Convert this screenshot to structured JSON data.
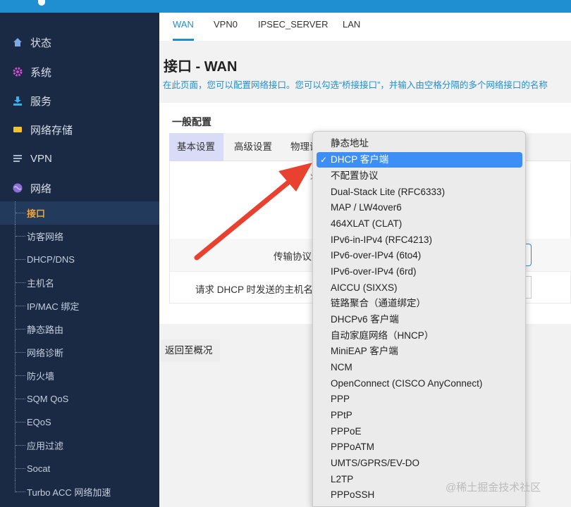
{
  "sidebar": {
    "menu": [
      {
        "label": "状态",
        "icon": "home-icon"
      },
      {
        "label": "系统",
        "icon": "gear-icon"
      },
      {
        "label": "服务",
        "icon": "download-icon"
      },
      {
        "label": "网络存储",
        "icon": "drive-icon"
      },
      {
        "label": "VPN",
        "icon": "list-icon"
      },
      {
        "label": "网络",
        "icon": "globe-icon"
      }
    ],
    "sub": [
      {
        "label": "接口"
      },
      {
        "label": "访客网络"
      },
      {
        "label": "DHCP/DNS"
      },
      {
        "label": "主机名"
      },
      {
        "label": "IP/MAC 绑定"
      },
      {
        "label": "静态路由"
      },
      {
        "label": "网络诊断"
      },
      {
        "label": "防火墙"
      },
      {
        "label": "SQM QoS"
      },
      {
        "label": "EQoS"
      },
      {
        "label": "应用过滤"
      },
      {
        "label": "Socat"
      },
      {
        "label": "Turbo ACC 网络加速"
      }
    ]
  },
  "tabs": [
    "WAN",
    "VPN0",
    "IPSEC_SERVER",
    "LAN"
  ],
  "page": {
    "title": "接口 - WAN",
    "description": "在此页面，您可以配置网络接口。您可以勾选“桥接接口”，并输入由空格分隔的多个网络接口的名称"
  },
  "config": {
    "section_title": "一般配置",
    "subtabs": [
      "基本设置",
      "高级设置",
      "物理设"
    ],
    "protocol_label": "传输协议",
    "hostname_label": "请求 DHCP 时发送的主机名",
    "status_fragment": "状"
  },
  "back_button": "返回至概况",
  "dropdown": {
    "selected_index": 1,
    "check": "✓",
    "options": [
      "静态地址",
      "DHCP 客户端",
      "不配置协议",
      "Dual-Stack Lite (RFC6333)",
      "MAP / LW4over6",
      "464XLAT (CLAT)",
      "IPv6-in-IPv4 (RFC4213)",
      "IPv6-over-IPv4 (6to4)",
      "IPv6-over-IPv4 (6rd)",
      "AICCU (SIXXS)",
      "链路聚合（通道绑定）",
      "DHCPv6 客户端",
      "自动家庭网络（HNCP）",
      "MiniEAP 客户端",
      "NCM",
      "OpenConnect (CISCO AnyConnect)",
      "PPP",
      "PPtP",
      "PPPoE",
      "PPPoATM",
      "UMTS/GPRS/EV-DO",
      "L2TP",
      "PPPoSSH"
    ]
  },
  "watermark": "@稀土掘金技术社区",
  "colors": {
    "accent": "#1f8fd1",
    "sidebar": "#1a2a44",
    "active_sub": "#f0a43a",
    "arrow": "#e8412f",
    "selected": "#3d8ef5"
  }
}
